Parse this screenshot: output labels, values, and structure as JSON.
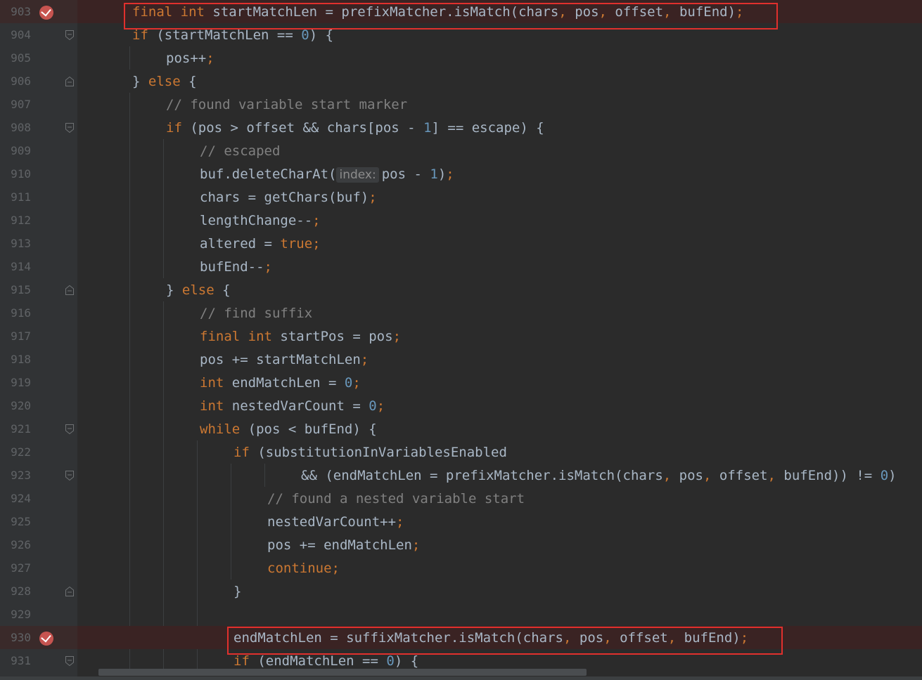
{
  "editor": {
    "lines": [
      {
        "num": "903",
        "breakpoint": true,
        "fold": "",
        "tokens": [
          [
            "kw",
            "final "
          ],
          [
            "kw",
            "int "
          ],
          [
            "op",
            "startMatchLen = prefixMatcher.isMatch(chars"
          ],
          [
            "kw",
            ", "
          ],
          [
            "op",
            "pos"
          ],
          [
            "kw",
            ", "
          ],
          [
            "op",
            "offset"
          ],
          [
            "kw",
            ", "
          ],
          [
            "op",
            "bufEnd)"
          ],
          [
            "kw",
            ";"
          ]
        ],
        "indent": 1
      },
      {
        "num": "904",
        "breakpoint": false,
        "fold": "open",
        "tokens": [
          [
            "kw",
            "if "
          ],
          [
            "op",
            "(startMatchLen == "
          ],
          [
            "num",
            "0"
          ],
          [
            "op",
            ") {"
          ]
        ],
        "indent": 1
      },
      {
        "num": "905",
        "breakpoint": false,
        "fold": "",
        "tokens": [
          [
            "op",
            "pos++"
          ],
          [
            "kw",
            ";"
          ]
        ],
        "indent": 2
      },
      {
        "num": "906",
        "breakpoint": false,
        "fold": "close",
        "tokens": [
          [
            "op",
            "} "
          ],
          [
            "kw",
            "else "
          ],
          [
            "op",
            "{"
          ]
        ],
        "indent": 1
      },
      {
        "num": "907",
        "breakpoint": false,
        "fold": "",
        "tokens": [
          [
            "cm",
            "// found variable start marker"
          ]
        ],
        "indent": 2
      },
      {
        "num": "908",
        "breakpoint": false,
        "fold": "open",
        "tokens": [
          [
            "kw",
            "if "
          ],
          [
            "op",
            "(pos > offset && chars[pos - "
          ],
          [
            "num",
            "1"
          ],
          [
            "op",
            "] == escape) {"
          ]
        ],
        "indent": 2
      },
      {
        "num": "909",
        "breakpoint": false,
        "fold": "",
        "tokens": [
          [
            "cm",
            "// escaped"
          ]
        ],
        "indent": 3
      },
      {
        "num": "910",
        "breakpoint": false,
        "fold": "",
        "tokens": [
          [
            "op",
            "buf.deleteCharAt("
          ],
          [
            "hint",
            "index:"
          ],
          [
            "op",
            "pos - "
          ],
          [
            "num",
            "1"
          ],
          [
            "op",
            ")"
          ],
          [
            "kw",
            ";"
          ]
        ],
        "indent": 3
      },
      {
        "num": "911",
        "breakpoint": false,
        "fold": "",
        "tokens": [
          [
            "op",
            "chars = getChars(buf)"
          ],
          [
            "kw",
            ";"
          ]
        ],
        "indent": 3
      },
      {
        "num": "912",
        "breakpoint": false,
        "fold": "",
        "tokens": [
          [
            "op",
            "lengthChange--"
          ],
          [
            "kw",
            ";"
          ]
        ],
        "indent": 3
      },
      {
        "num": "913",
        "breakpoint": false,
        "fold": "",
        "tokens": [
          [
            "op",
            "altered = "
          ],
          [
            "kw",
            "true"
          ],
          [
            "kw",
            ";"
          ]
        ],
        "indent": 3
      },
      {
        "num": "914",
        "breakpoint": false,
        "fold": "",
        "tokens": [
          [
            "op",
            "bufEnd--"
          ],
          [
            "kw",
            ";"
          ]
        ],
        "indent": 3
      },
      {
        "num": "915",
        "breakpoint": false,
        "fold": "close",
        "tokens": [
          [
            "op",
            "} "
          ],
          [
            "kw",
            "else "
          ],
          [
            "op",
            "{"
          ]
        ],
        "indent": 2
      },
      {
        "num": "916",
        "breakpoint": false,
        "fold": "",
        "tokens": [
          [
            "cm",
            "// find suffix"
          ]
        ],
        "indent": 3
      },
      {
        "num": "917",
        "breakpoint": false,
        "fold": "",
        "tokens": [
          [
            "kw",
            "final "
          ],
          [
            "kw",
            "int "
          ],
          [
            "op",
            "startPos = pos"
          ],
          [
            "kw",
            ";"
          ]
        ],
        "indent": 3
      },
      {
        "num": "918",
        "breakpoint": false,
        "fold": "",
        "tokens": [
          [
            "op",
            "pos += startMatchLen"
          ],
          [
            "kw",
            ";"
          ]
        ],
        "indent": 3
      },
      {
        "num": "919",
        "breakpoint": false,
        "fold": "",
        "tokens": [
          [
            "kw",
            "int "
          ],
          [
            "op",
            "endMatchLen = "
          ],
          [
            "num",
            "0"
          ],
          [
            "kw",
            ";"
          ]
        ],
        "indent": 3
      },
      {
        "num": "920",
        "breakpoint": false,
        "fold": "",
        "tokens": [
          [
            "kw",
            "int "
          ],
          [
            "op",
            "nestedVarCount = "
          ],
          [
            "num",
            "0"
          ],
          [
            "kw",
            ";"
          ]
        ],
        "indent": 3
      },
      {
        "num": "921",
        "breakpoint": false,
        "fold": "open",
        "tokens": [
          [
            "kw",
            "while "
          ],
          [
            "op",
            "(pos < bufEnd) {"
          ]
        ],
        "indent": 3
      },
      {
        "num": "922",
        "breakpoint": false,
        "fold": "",
        "tokens": [
          [
            "kw",
            "if "
          ],
          [
            "op",
            "(substitutionInVariablesEnabled"
          ]
        ],
        "indent": 4
      },
      {
        "num": "923",
        "breakpoint": false,
        "fold": "open",
        "tokens": [
          [
            "op",
            "&& (endMatchLen = prefixMatcher.isMatch(chars"
          ],
          [
            "kw",
            ", "
          ],
          [
            "op",
            "pos"
          ],
          [
            "kw",
            ", "
          ],
          [
            "op",
            "offset"
          ],
          [
            "kw",
            ", "
          ],
          [
            "op",
            "bufEnd)) != "
          ],
          [
            "num",
            "0"
          ],
          [
            "op",
            ")"
          ]
        ],
        "indent": 6
      },
      {
        "num": "924",
        "breakpoint": false,
        "fold": "",
        "tokens": [
          [
            "cm",
            "// found a nested variable start"
          ]
        ],
        "indent": 5
      },
      {
        "num": "925",
        "breakpoint": false,
        "fold": "",
        "tokens": [
          [
            "op",
            "nestedVarCount++"
          ],
          [
            "kw",
            ";"
          ]
        ],
        "indent": 5
      },
      {
        "num": "926",
        "breakpoint": false,
        "fold": "",
        "tokens": [
          [
            "op",
            "pos += endMatchLen"
          ],
          [
            "kw",
            ";"
          ]
        ],
        "indent": 5
      },
      {
        "num": "927",
        "breakpoint": false,
        "fold": "",
        "tokens": [
          [
            "kw",
            "continue"
          ],
          [
            "kw",
            ";"
          ]
        ],
        "indent": 5
      },
      {
        "num": "928",
        "breakpoint": false,
        "fold": "close",
        "tokens": [
          [
            "op",
            "}"
          ]
        ],
        "indent": 4
      },
      {
        "num": "929",
        "breakpoint": false,
        "fold": "",
        "tokens": [],
        "indent": 4
      },
      {
        "num": "930",
        "breakpoint": true,
        "fold": "",
        "tokens": [
          [
            "op",
            "endMatchLen = suffixMatcher.isMatch(chars"
          ],
          [
            "kw",
            ", "
          ],
          [
            "op",
            "pos"
          ],
          [
            "kw",
            ", "
          ],
          [
            "op",
            "offset"
          ],
          [
            "kw",
            ", "
          ],
          [
            "op",
            "bufEnd)"
          ],
          [
            "kw",
            ";"
          ]
        ],
        "indent": 4
      },
      {
        "num": "931",
        "breakpoint": false,
        "fold": "open",
        "tokens": [
          [
            "kw",
            "if "
          ],
          [
            "op",
            "(endMatchLen == "
          ],
          [
            "num",
            "0"
          ],
          [
            "op",
            ") {"
          ]
        ],
        "indent": 4
      }
    ]
  },
  "colors": {
    "background": "#2b2b2b",
    "keyword": "#cc7832",
    "number": "#6897bb",
    "comment": "#808080",
    "text": "#a9b7c6",
    "highlight_box": "#e0302d",
    "breakpoint": "#c75450"
  },
  "icons": {
    "breakpoint": "breakpoint-verified-icon",
    "fold_open": "fold-open-icon",
    "fold_close": "fold-close-icon"
  }
}
